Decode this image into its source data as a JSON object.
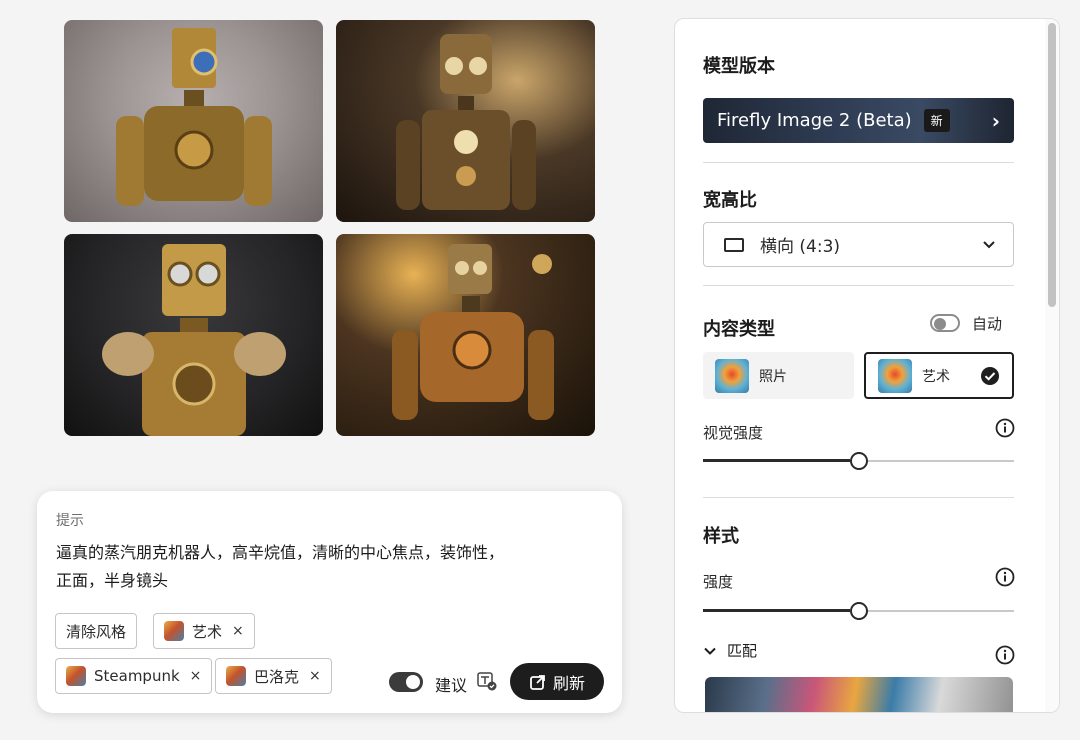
{
  "gallery": {
    "images": [
      {
        "name": "image-1"
      },
      {
        "name": "image-2"
      },
      {
        "name": "image-3"
      },
      {
        "name": "image-4"
      }
    ]
  },
  "prompt": {
    "label": "提示",
    "line1": "逼真的蒸汽朋克机器人，高辛烷值，清晰的中心焦点，装饰性，",
    "line2": "正面，半身镜头",
    "clear_style_label": "清除风格",
    "chips": [
      {
        "label": "艺术",
        "remove": "×"
      },
      {
        "label": "Steampunk",
        "remove": "×"
      },
      {
        "label": "巴洛克",
        "remove": "×"
      }
    ],
    "suggest_label": "建议",
    "suggest_enabled": true,
    "refresh_label": "刷新"
  },
  "panel": {
    "model": {
      "title": "模型版本",
      "value": "Firefly Image 2 (Beta)",
      "badge": "新",
      "chevron": "›"
    },
    "aspect": {
      "title": "宽高比",
      "value": "横向 (4:3)"
    },
    "content_type": {
      "title": "内容类型",
      "auto_label": "自动",
      "auto_enabled": false,
      "options": [
        {
          "label": "照片",
          "selected": false
        },
        {
          "label": "艺术",
          "selected": true
        }
      ]
    },
    "visual_intensity": {
      "label": "视觉强度",
      "value": 0.5
    },
    "style": {
      "title": "样式",
      "strength_label": "强度",
      "strength_value": 0.5,
      "match_label": "匹配"
    }
  },
  "colors": {
    "accent_dark": "#1d1d1d",
    "panel_bg": "#ffffff",
    "page_bg": "#f4f4f4"
  }
}
